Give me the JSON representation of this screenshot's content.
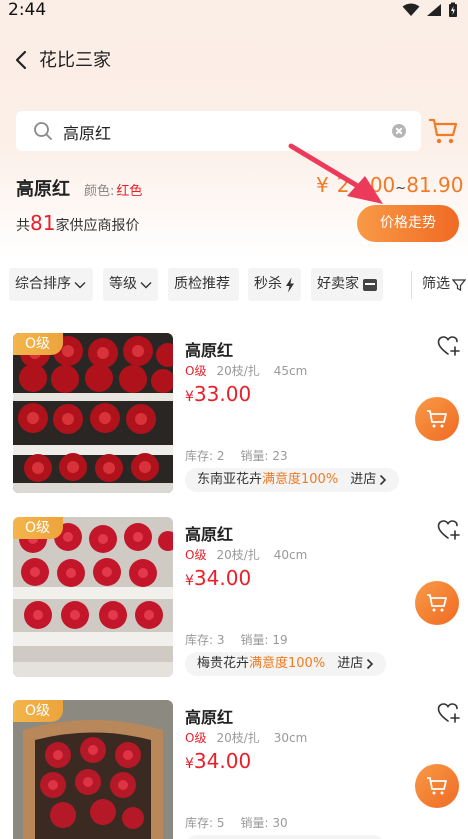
{
  "status_bar": {
    "time": "2:44"
  },
  "nav": {
    "title": "花比三家"
  },
  "search": {
    "value": "高原红"
  },
  "product": {
    "name": "高原红",
    "color_label": "颜色:",
    "color_value": "红色",
    "price_prefix": "¥",
    "price_low_partial": "2",
    "price_low_tail": ".00",
    "price_sep": "~",
    "price_high": "81.90",
    "supplier_prefix": "共",
    "supplier_count": "81",
    "supplier_suffix": "家供应商报价",
    "trend_button": "价格走势"
  },
  "filters": {
    "sort": "综合排序",
    "grade": "等级",
    "inspect": "质检推荐",
    "flash": "秒杀",
    "good_seller": "好卖家",
    "filter": "筛选"
  },
  "listings": [
    {
      "grade_tag": "O级",
      "name": "高原红",
      "grade": "O级",
      "bundle": "20枝/扎",
      "length": "45cm",
      "price_symbol": "¥",
      "price": "33.00",
      "stock": "库存: 2",
      "sales": "销量: 23",
      "shop": "东南亚花卉",
      "rating": "满意度100%",
      "enter": "进店"
    },
    {
      "grade_tag": "O级",
      "name": "高原红",
      "grade": "O级",
      "bundle": "20枝/扎",
      "length": "40cm",
      "price_symbol": "¥",
      "price": "34.00",
      "stock": "库存: 3",
      "sales": "销量: 19",
      "shop": "梅贵花卉",
      "rating": "满意度100%",
      "enter": "进店"
    },
    {
      "grade_tag": "O级",
      "name": "高原红",
      "grade": "O级",
      "bundle": "20枝/扎",
      "length": "30cm",
      "price_symbol": "¥",
      "price": "34.00",
      "stock": "库存: 5",
      "sales": "销量: 30",
      "shop": "",
      "rating": "",
      "enter": ""
    }
  ],
  "colors": {
    "accent_orange": "#f27a25",
    "price_red": "#e8202a",
    "grade_gold": "#f0aa3f",
    "annotation_arrow": "#ec3b5a"
  }
}
